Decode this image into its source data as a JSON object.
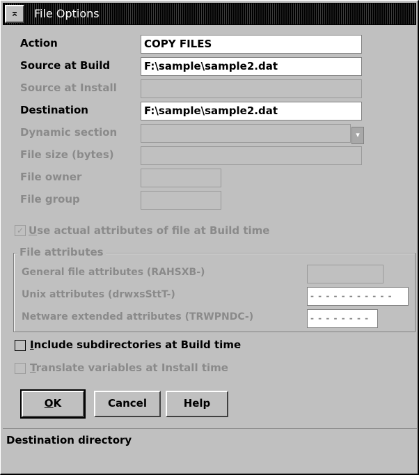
{
  "window": {
    "title": "File Options"
  },
  "form": {
    "action_label": "Action",
    "action_value": "COPY FILES",
    "source_build_label": "Source at Build",
    "source_build_value": "F:\\sample\\sample2.dat",
    "source_install_label": "Source at Install",
    "source_install_value": "",
    "destination_label": "Destination",
    "destination_value": "F:\\sample\\sample2.dat",
    "dynamic_section_label": "Dynamic section",
    "dynamic_section_value": "",
    "file_size_label": "File size (bytes)",
    "file_size_value": "",
    "file_owner_label": "File owner",
    "file_owner_value": "",
    "file_group_label": "File group",
    "file_group_value": ""
  },
  "use_actual": {
    "checked": true,
    "label_first": "U",
    "label_rest": "se actual attributes of file at Build time"
  },
  "attributes": {
    "group_title": "File attributes",
    "general_label": "General file attributes (RAHSXB-)",
    "general_value": "",
    "unix_label": "Unix attributes (drwxsSttT-)",
    "unix_value": "- - - - - - - - - - -",
    "netware_label": "Netware extended attributes (TRWPNDC-)",
    "netware_value": "- - - - - - - -"
  },
  "include_subdirs": {
    "checked": false,
    "label_first": "I",
    "label_rest": "nclude subdirectories at Build time"
  },
  "translate_vars": {
    "checked": false,
    "label_first": "T",
    "label_rest": "ranslate variables at Install time"
  },
  "buttons": {
    "ok_first": "O",
    "ok_rest": "K",
    "cancel": "Cancel",
    "help": "Help"
  },
  "status": {
    "text": "Destination directory"
  }
}
